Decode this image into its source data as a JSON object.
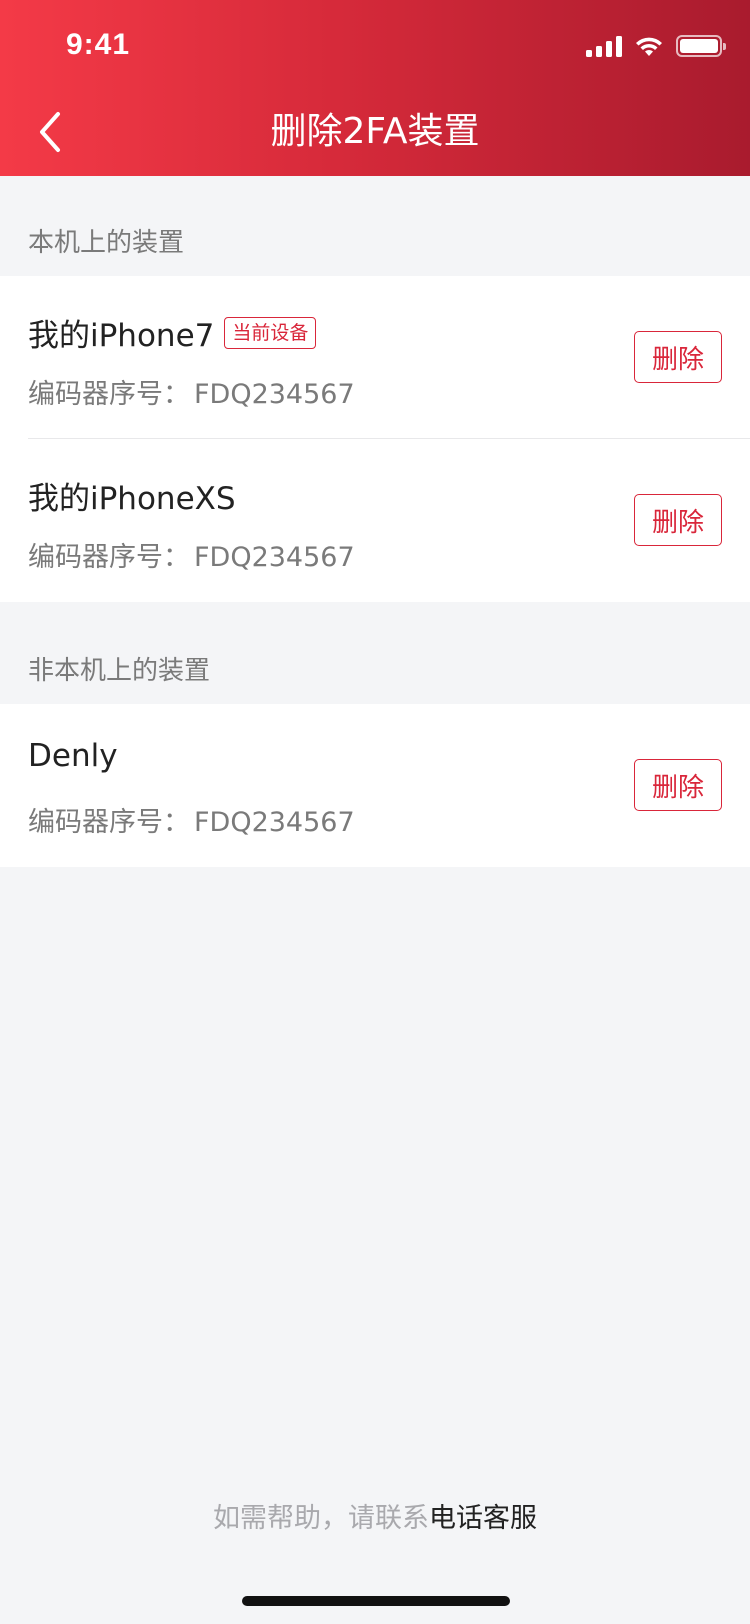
{
  "status_bar": {
    "time": "9:41"
  },
  "header": {
    "title": "删除2FA装置"
  },
  "sections": [
    {
      "label": "本机上的装置",
      "devices": [
        {
          "name": "我的iPhone7",
          "tag": "当前设备",
          "serial_label": "编码器序号：",
          "serial": "FDQ234567",
          "delete_label": "删除"
        },
        {
          "name": "我的iPhoneXS",
          "serial_label": "编码器序号：",
          "serial": "FDQ234567",
          "delete_label": "删除"
        }
      ]
    },
    {
      "label": "非本机上的装置",
      "devices": [
        {
          "name": "Denly",
          "serial_label": "编码器序号：",
          "serial": "FDQ234567",
          "delete_label": "删除"
        }
      ]
    }
  ],
  "footer": {
    "help_text": "如需帮助，请联系",
    "link_text": "电话客服"
  },
  "colors": {
    "accent": "#d9263a",
    "header_start": "#f43a47",
    "header_end": "#a91b2e",
    "background": "#f4f5f7"
  },
  "battery_level": 1.0,
  "signal_bars": 4
}
